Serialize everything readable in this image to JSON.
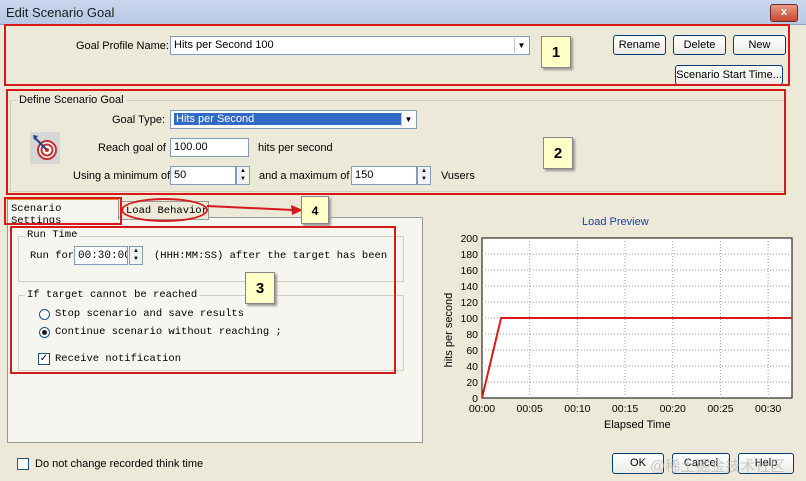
{
  "window": {
    "title": "Edit Scenario Goal",
    "close_glyph": "x"
  },
  "goal_profile": {
    "label": "Goal Profile Name:",
    "value": "Hits per Second 100",
    "buttons": {
      "rename": "Rename",
      "delete": "Delete",
      "new": "New"
    },
    "start_time_button": "Scenario Start Time..."
  },
  "define": {
    "title": "Define Scenario Goal",
    "goal_type_label": "Goal Type:",
    "goal_type_value": "Hits per Second",
    "reach_label": "Reach goal of",
    "reach_value": "100.00",
    "reach_unit": "hits per second",
    "min_label": "Using a minimum of",
    "min_value": "50",
    "max_label": "and a maximum of",
    "max_value": "150",
    "vusers_label": "Vusers"
  },
  "tabs": {
    "settings": "Scenario Settings",
    "load": "Load Behavior"
  },
  "run_time": {
    "title": "Run Time",
    "run_for_label": "Run for",
    "run_for_value": "00:30:00",
    "format_hint": "(HHH:MM:SS)  after the target has been"
  },
  "target": {
    "title": "If target cannot be reached",
    "stop_label": "Stop scenario and save results",
    "continue_label": "Continue scenario without reaching ;",
    "notify_label": "Receive notification",
    "selected": "continue",
    "notify_checked": true
  },
  "callouts": {
    "c1": "1",
    "c2": "2",
    "c3": "3",
    "c4": "4"
  },
  "think_time": {
    "label": "Do not change recorded think time",
    "checked": false
  },
  "footer": {
    "ok": "OK",
    "cancel": "Cancel",
    "help": "Help",
    "watermark": "@稀土掘金技术社区"
  },
  "colors": {
    "annotation": "#d61a1a",
    "chart_line": "#d61a1a",
    "chart_title": "#1b3fa8"
  },
  "chart_data": {
    "type": "line",
    "title": "Load Preview",
    "xlabel": "Elapsed Time",
    "ylabel": "hits per second",
    "x_ticks": [
      "00:00",
      "00:05",
      "00:10",
      "00:15",
      "00:20",
      "00:25",
      "00:30"
    ],
    "y_ticks": [
      0,
      20,
      40,
      60,
      80,
      100,
      120,
      140,
      160,
      180,
      200
    ],
    "ylim": [
      0,
      200
    ],
    "xlim_minutes": [
      0,
      32.5
    ],
    "grid": true,
    "series": [
      {
        "points": [
          [
            0,
            0
          ],
          [
            2,
            100
          ],
          [
            32.5,
            100
          ]
        ]
      }
    ]
  }
}
